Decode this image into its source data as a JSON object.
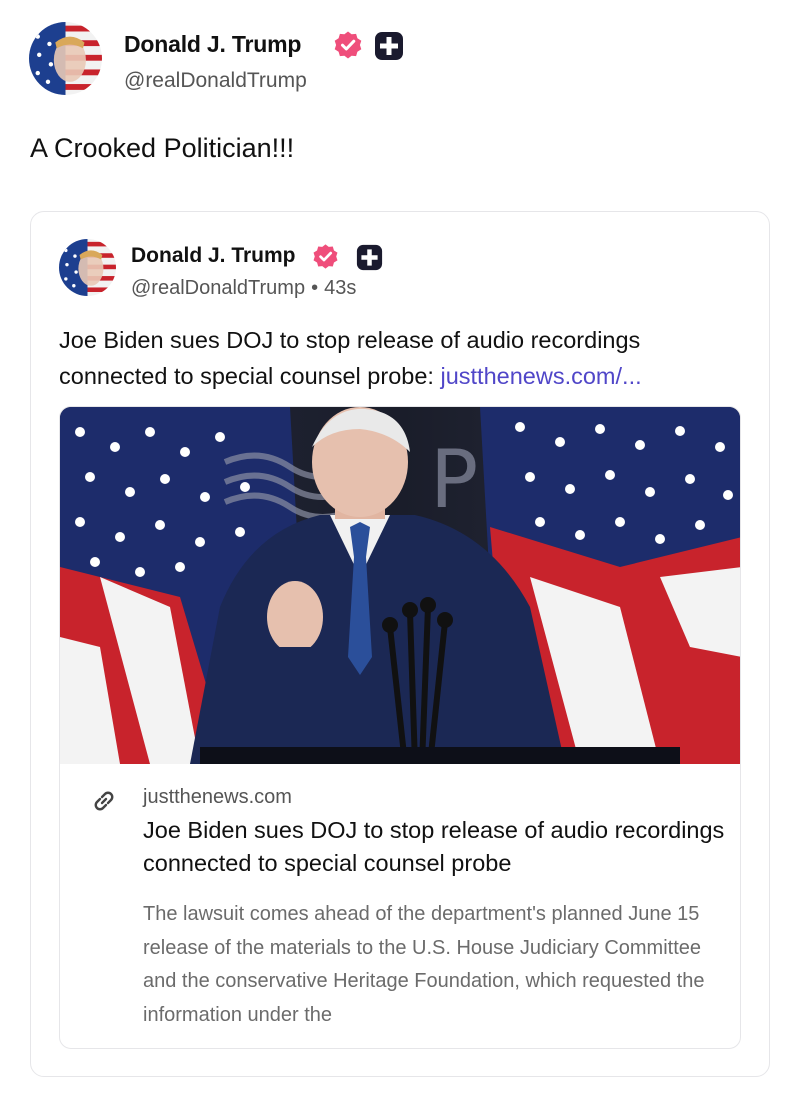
{
  "post": {
    "author": {
      "name": "Donald J. Trump",
      "handle": "@realDonaldTrump",
      "verified_badge_icon": "verified-check-badge-icon",
      "plus_badge_icon": "plus-badge-icon"
    },
    "text": "A Crooked Politician!!!",
    "quoted_post": {
      "author": {
        "name": "Donald J. Trump",
        "handle": "@realDonaldTrump",
        "separator": "•",
        "time_ago": "43s"
      },
      "text": "Joe Biden sues DOJ to stop release of audio recordings connected to special counsel probe: ",
      "link_text": "justthenews.com/...",
      "link_card": {
        "domain": "justthenews.com",
        "title": "Joe Biden sues DOJ to stop release of audio recordings connected to special counsel probe",
        "description": "The lawsuit comes ahead of the department's planned June 15 release of the materials to the U.S. House Judiciary Committee and the conservative Heritage Foundation, which requested the information under the",
        "link_icon": "chain-link-icon"
      }
    }
  },
  "colors": {
    "verified_badge": "#ef4e7b",
    "link": "#5046c8",
    "plus_badge": "#1a1a2e",
    "secondary_text": "#555555"
  }
}
